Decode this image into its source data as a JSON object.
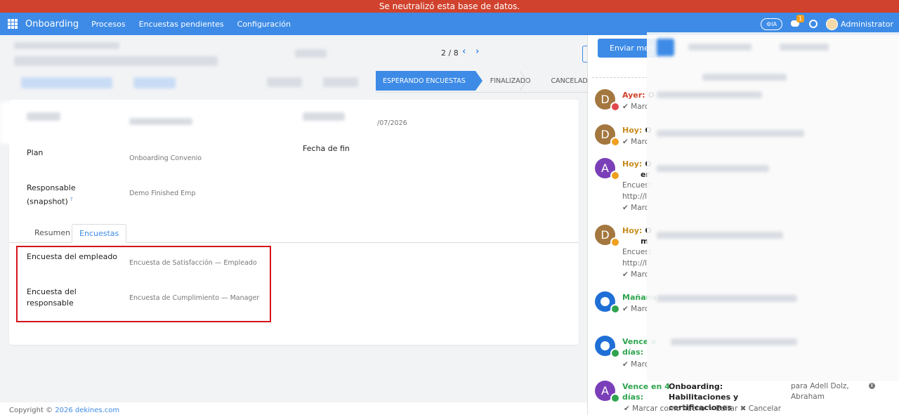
{
  "banner": {
    "text": "Se neutralizó esta base de datos."
  },
  "navbar": {
    "brand": "Onboarding",
    "menu": [
      "Procesos",
      "Encuestas pendientes",
      "Configuración"
    ],
    "ia_label": "IA",
    "chat_badge": "1",
    "user_name": "Administrator"
  },
  "pager": {
    "value": "2 / 8"
  },
  "statusbar": {
    "stages": [
      "ESPERANDO ENCUESTAS",
      "FINALIZADO",
      "CANCELADO"
    ],
    "active": "ESPERANDO ENCUESTAS"
  },
  "form": {
    "date_fragment": "/07/2026",
    "plan_label": "Plan",
    "plan_value": "Onboarding Convenio",
    "end_date_label": "Fecha de fin",
    "responsible_label": "Responsable (snapshot)",
    "responsible_tooltip": "?",
    "responsible_value": "Demo Finished Emp",
    "tabs": [
      "Resumen",
      "Encuestas"
    ],
    "active_tab": "Encuestas",
    "employee_survey_label": "Encuesta del empleado",
    "employee_survey_value": "Encuesta de Satisfacción — Empleado",
    "responsible_survey_label": "Encuesta del responsable",
    "responsible_survey_value": "Encuesta de Cumplimiento — Manager"
  },
  "footer": {
    "copyright": "Copyright ©",
    "link": "2026 dekines.com"
  },
  "chatter": {
    "send_button": "Enviar men",
    "activities": [
      {
        "initial": "D",
        "when": "Ayer:",
        "title_fragment": "O",
        "sub": "✔ Marc",
        "avatar_color": "#a3773f",
        "mini_color": "#e0474c",
        "when_color": "#d0422d"
      },
      {
        "initial": "D",
        "when": "Hoy:",
        "title_fragment": "O",
        "sub": "✔ Marc",
        "avatar_color": "#a3773f",
        "mini_color": "#f0a020",
        "when_color": "#c78a1c"
      },
      {
        "initial": "A",
        "when": "Hoy:",
        "title_fragment": "O",
        "title_fragment2": "er",
        "text1": "Encuest",
        "text2": "http://l",
        "sub": "✔ Marc",
        "avatar_color": "#7a3fb8",
        "mini_color": "#f0a020",
        "when_color": "#c78a1c"
      },
      {
        "initial": "D",
        "when": "Hoy:",
        "title_fragment": "O",
        "title_fragment2": "m",
        "text1": "Encuest",
        "text2": "http://l",
        "sub": "✔ Marc",
        "avatar_color": "#a3773f",
        "mini_color": "#f0a020",
        "when_color": "#c78a1c"
      },
      {
        "initial": "",
        "when": "Mañana",
        "sub": "✔ Marc",
        "avatar_color": "#1f6fd6",
        "mini_color": "#2ea44f",
        "when_color": "#2ea44f"
      },
      {
        "initial": "",
        "when": "Vence e",
        "when2": "días:",
        "sub": "✔ Marc",
        "avatar_color": "#1f6fd6",
        "mini_color": "#2ea44f",
        "when_color": "#2ea44f"
      },
      {
        "initial": "A",
        "when": "Vence en 4",
        "when2": "días:",
        "title": "Onboarding: Habilitaciones y certificaciones",
        "assign": "para Adell Dolz, Abraham",
        "actions": "✔ Marcar como hecho     ✎ Editar     ✖ Cancelar",
        "avatar_color": "#7a3fb8",
        "mini_color": "#2ea44f",
        "when_color": "#2ea44f"
      }
    ]
  }
}
